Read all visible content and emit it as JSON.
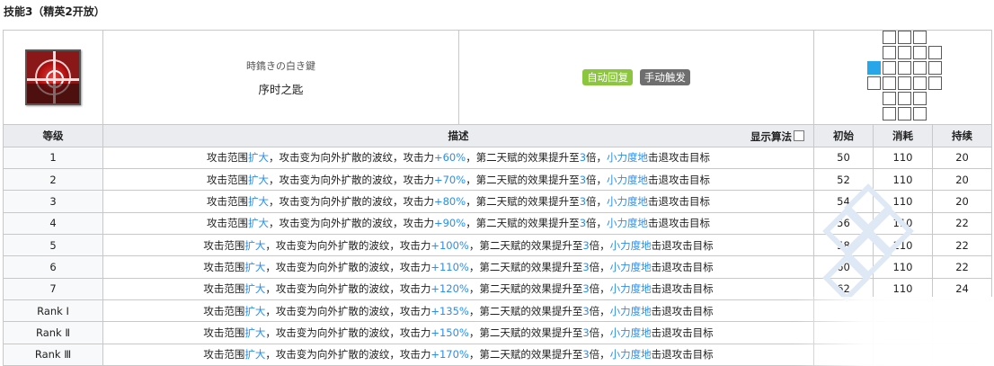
{
  "page_title": "技能3（精英2开放）",
  "skill": {
    "icon": "skill-crosshair-icon",
    "name_ja": "時鐫きの白き鍵",
    "name_zh": "序时之匙",
    "badges": [
      {
        "label": "自动回复",
        "color": "#8cc63f"
      },
      {
        "label": "手动触发",
        "color": "#6e6e6e"
      }
    ],
    "range_highlight_color": "#27a6e9"
  },
  "columns": {
    "level": "等级",
    "desc": "描述",
    "show_calc": "显示算法",
    "initial": "初始",
    "cost": "消耗",
    "duration": "持续"
  },
  "desc_parts": {
    "p1": "攻击范围",
    "k1": "扩大",
    "p2": "，攻击变为向外扩散的波纹，攻击力",
    "p3": "，第二天赋的效果提升至",
    "k3": "3",
    "p4": "倍，",
    "k4": "小力度地",
    "p5": "击退攻击目标"
  },
  "rows": [
    {
      "level": "1",
      "atk": "+60%",
      "initial": "50",
      "cost": "110",
      "duration": "20"
    },
    {
      "level": "2",
      "atk": "+70%",
      "initial": "52",
      "cost": "110",
      "duration": "20"
    },
    {
      "level": "3",
      "atk": "+80%",
      "initial": "54",
      "cost": "110",
      "duration": "20"
    },
    {
      "level": "4",
      "atk": "+90%",
      "initial": "56",
      "cost": "110",
      "duration": "22"
    },
    {
      "level": "5",
      "atk": "+100%",
      "initial": "58",
      "cost": "110",
      "duration": "22"
    },
    {
      "level": "6",
      "atk": "+110%",
      "initial": "60",
      "cost": "110",
      "duration": "22"
    },
    {
      "level": "7",
      "atk": "+120%",
      "initial": "62",
      "cost": "110",
      "duration": "24"
    },
    {
      "level": "Rank Ⅰ",
      "atk": "+135%",
      "initial": "",
      "cost": "",
      "duration": ""
    },
    {
      "level": "Rank Ⅱ",
      "atk": "+150%",
      "initial": "",
      "cost": "",
      "duration": ""
    },
    {
      "level": "Rank Ⅲ",
      "atk": "+170%",
      "initial": "",
      "cost": "",
      "duration": ""
    }
  ]
}
